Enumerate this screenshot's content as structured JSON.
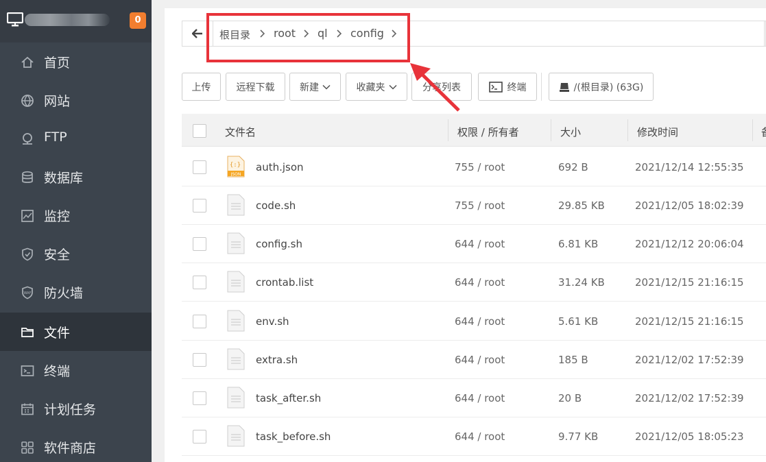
{
  "sidebar": {
    "badge": "0",
    "items": [
      {
        "label": "首页",
        "icon": "home-icon"
      },
      {
        "label": "网站",
        "icon": "globe-icon"
      },
      {
        "label": "FTP",
        "icon": "ftp-icon"
      },
      {
        "label": "数据库",
        "icon": "database-icon"
      },
      {
        "label": "监控",
        "icon": "monitor-chart-icon"
      },
      {
        "label": "安全",
        "icon": "shield-icon"
      },
      {
        "label": "防火墙",
        "icon": "waf-shield-icon"
      },
      {
        "label": "文件",
        "icon": "folder-icon"
      },
      {
        "label": "终端",
        "icon": "terminal-icon"
      },
      {
        "label": "计划任务",
        "icon": "calendar-icon"
      },
      {
        "label": "软件商店",
        "icon": "apps-grid-icon"
      }
    ],
    "active_index": 7
  },
  "breadcrumb": [
    "根目录",
    "root",
    "ql",
    "config"
  ],
  "toolbar": {
    "upload": "上传",
    "remote_download": "远程下载",
    "new": "新建",
    "favorites": "收藏夹",
    "share_list": "分享列表",
    "terminal": "终端",
    "disk": "/(根目录) (63G)"
  },
  "table": {
    "headers": {
      "name": "文件名",
      "perm": "权限 / 所有者",
      "size": "大小",
      "mtime": "修改时间"
    },
    "rows": [
      {
        "name": "auth.json",
        "perm": "755 / root",
        "size": "692 B",
        "mtime": "2021/12/14 12:55:35",
        "icon": "json-file-icon"
      },
      {
        "name": "code.sh",
        "perm": "755 / root",
        "size": "29.85 KB",
        "mtime": "2021/12/05 18:02:39",
        "icon": "file-icon"
      },
      {
        "name": "config.sh",
        "perm": "644 / root",
        "size": "6.81 KB",
        "mtime": "2021/12/12 20:06:04",
        "icon": "file-icon"
      },
      {
        "name": "crontab.list",
        "perm": "644 / root",
        "size": "31.24 KB",
        "mtime": "2021/12/15 21:16:15",
        "icon": "file-icon"
      },
      {
        "name": "env.sh",
        "perm": "644 / root",
        "size": "5.61 KB",
        "mtime": "2021/12/15 21:16:15",
        "icon": "file-icon"
      },
      {
        "name": "extra.sh",
        "perm": "644 / root",
        "size": "185 B",
        "mtime": "2021/12/02 17:52:39",
        "icon": "file-icon"
      },
      {
        "name": "task_after.sh",
        "perm": "644 / root",
        "size": "20 B",
        "mtime": "2021/12/02 17:52:39",
        "icon": "file-icon"
      },
      {
        "name": "task_before.sh",
        "perm": "644 / root",
        "size": "9.77 KB",
        "mtime": "2021/12/05 18:05:23",
        "icon": "file-icon"
      }
    ]
  },
  "colors": {
    "sidebar_bg": "#3c444d",
    "sidebar_active": "#2e343b",
    "badge": "#f27e2f",
    "highlight": "#e8333a",
    "json_icon": "#f5a623"
  }
}
